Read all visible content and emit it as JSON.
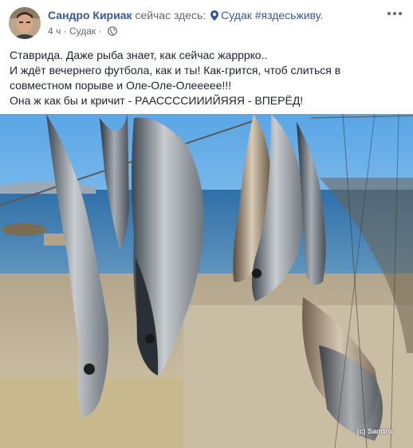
{
  "post": {
    "author": "Сандро Кириак",
    "status_text": "сейчас здесь:",
    "location": "Судак #яздесьживу.",
    "time": "4 ч",
    "meta_location": "Судак",
    "privacy_icon": "globe-icon",
    "more_icon": "more-options-icon",
    "text_lines": [
      "Ставрида. Даже рыба знает, как сейчас жаррркo..",
      "И ждёт вечернего футбола, как и ты! Как-грится, чтоб слиться в",
      "совместном порыве и Оле-Оле-Олееееe!!!",
      "Она ж как бы и кричит - РААССССИИИЙЯЯЯ - ВПЕРЁД!"
    ],
    "photo_watermark": "(c) Sandro"
  },
  "colors": {
    "link": "#385898",
    "meta": "#616770",
    "text": "#1d2129"
  }
}
